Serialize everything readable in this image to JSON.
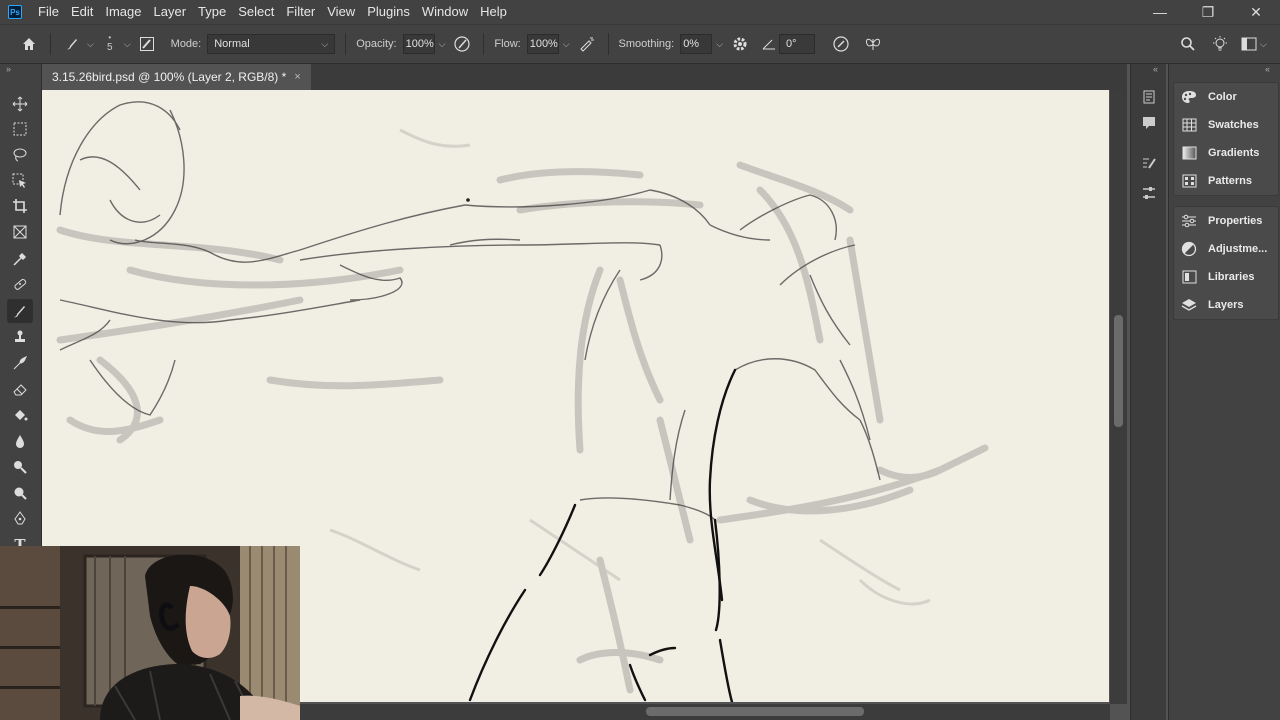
{
  "app": {
    "logo_text": "Ps"
  },
  "menu": [
    "File",
    "Edit",
    "Image",
    "Layer",
    "Type",
    "Select",
    "Filter",
    "View",
    "Plugins",
    "Window",
    "Help"
  ],
  "window_controls": {
    "minimize": "—",
    "restore": "❐",
    "close": "✕"
  },
  "options": {
    "brush_size": "5",
    "mode_label": "Mode:",
    "mode_value": "Normal",
    "opacity_label": "Opacity:",
    "opacity_value": "100%",
    "flow_label": "Flow:",
    "flow_value": "100%",
    "smoothing_label": "Smoothing:",
    "smoothing_value": "0%",
    "angle_value": "0°"
  },
  "document": {
    "tab_title": "3.15.26bird.psd @ 100% (Layer 2, RGB/8) *",
    "close": "×"
  },
  "tools": [
    "move-tool",
    "marquee-tool",
    "lasso-tool",
    "object-selection-tool",
    "crop-tool",
    "frame-tool",
    "eyedropper-tool",
    "healing-brush-tool",
    "brush-tool",
    "clone-stamp-tool",
    "history-brush-tool",
    "eraser-tool",
    "paint-bucket-tool",
    "blur-tool",
    "dodge-tool",
    "zoom-tool",
    "pen-tool",
    "type-tool"
  ],
  "panels": {
    "group1": [
      "Color",
      "Swatches",
      "Gradients",
      "Patterns"
    ],
    "group2": [
      "Properties",
      "Adjustme...",
      "Libraries",
      "Layers"
    ]
  },
  "colors": {
    "canvas": "#f1eee4",
    "ui_dark": "#424242",
    "accent": "#31a8ff"
  }
}
